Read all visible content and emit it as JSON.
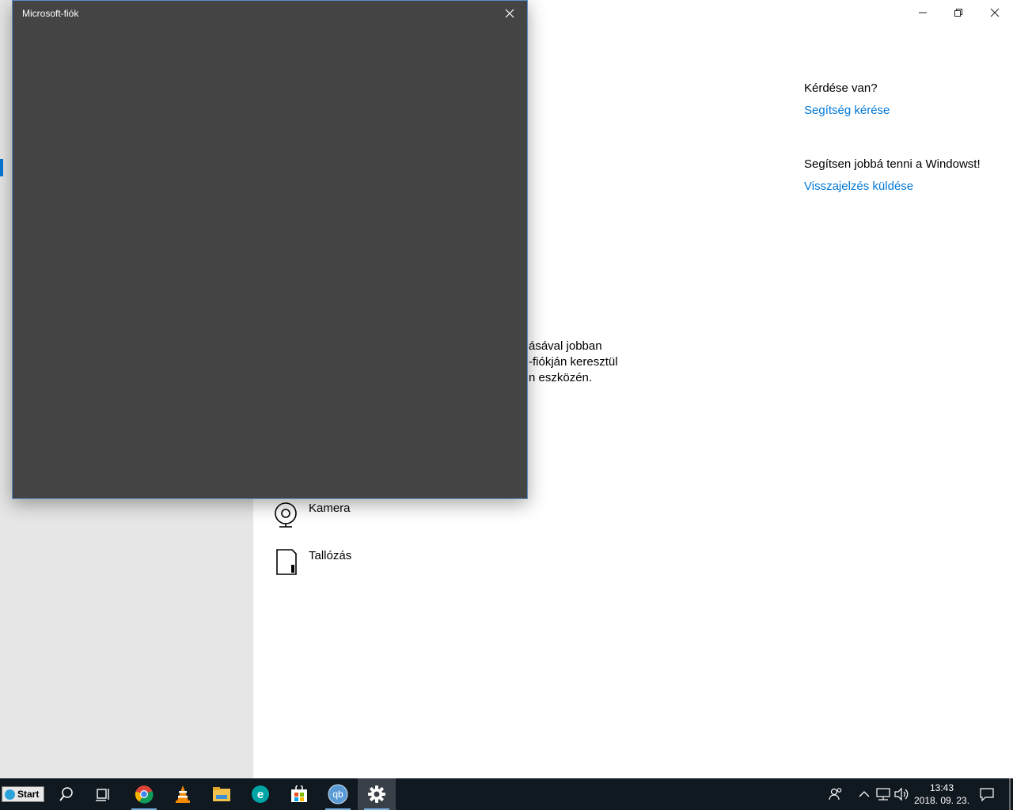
{
  "settings": {
    "window_controls": {
      "minimize": "minimize",
      "restore": "restore",
      "close": "close"
    },
    "help": {
      "question_title": "Kérdése van?",
      "question_link": "Segítség kérése",
      "feedback_title": "Segítsen jobbá tenni a Windowst!",
      "feedback_link": "Visszajelzés küldése"
    },
    "description_lines": [
      "ásával jobban",
      "-fiókján keresztül",
      "n eszközén."
    ],
    "options": [
      {
        "label": "Kamera",
        "icon": "camera-icon"
      },
      {
        "label": "Tallózás",
        "icon": "browse-icon"
      }
    ]
  },
  "dialog": {
    "title": "Microsoft-fiók"
  },
  "taskbar": {
    "start_label": "Start",
    "apps": [
      {
        "name": "search-icon"
      },
      {
        "name": "task-view-icon"
      },
      {
        "name": "chrome-icon"
      },
      {
        "name": "vlc-icon"
      },
      {
        "name": "file-explorer-icon"
      },
      {
        "name": "eset-icon"
      },
      {
        "name": "store-icon"
      },
      {
        "name": "qbittorrent-icon",
        "text": "qb"
      },
      {
        "name": "settings-gear-icon"
      }
    ],
    "clock_time": "13:43",
    "clock_date": "2018. 09. 23."
  },
  "colors": {
    "accent": "#0078d7",
    "dialog_bg": "#444444",
    "sidebar_bg": "#e6e6e6",
    "taskbar_bg": "#101820"
  }
}
